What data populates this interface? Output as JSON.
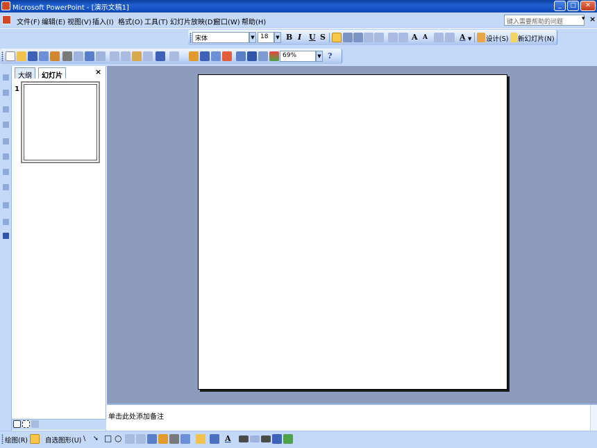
{
  "window": {
    "title": "Microsoft PowerPoint - [演示文稿1]",
    "minimize": "_",
    "maximize": "□",
    "close": "✕"
  },
  "menu": {
    "items": [
      "文件(F)",
      "编辑(E)",
      "视图(V)",
      "插入(I)",
      "格式(O)",
      "工具(T)",
      "幻灯片放映(D)",
      "窗口(W)",
      "帮助(H)"
    ],
    "help_placeholder": "键入需要帮助的问题",
    "help_arrow": "▾",
    "doc_close": "×"
  },
  "format_toolbar": {
    "font": "宋体",
    "size": "18",
    "bold": "B",
    "italic": "I",
    "underline": "U",
    "shadow": "S",
    "font_color": "A",
    "design": "设计(S)",
    "new_slide": "新幻灯片(N)",
    "dropdown": "▼"
  },
  "standard_toolbar": {
    "zoom": "69%",
    "dropdown": "▼",
    "help": "?"
  },
  "slide_pane": {
    "tabs": [
      "大纲",
      "幻灯片"
    ],
    "active_tab": "幻灯片",
    "close": "×",
    "slide_number": "1"
  },
  "notes": {
    "placeholder": "单击此处添加备注"
  },
  "drawing_toolbar": {
    "draw": "绘图(R)",
    "autoshapes": "自选图形(U)",
    "line_icon": "\\",
    "arrow_icon": "➘",
    "rect_icon": "□",
    "oval_icon": "○",
    "font_color": "A"
  },
  "colors": {
    "chrome": "#c4d8f7",
    "workspace": "#8d9bbd",
    "titlebar": "#1f5fd0"
  }
}
